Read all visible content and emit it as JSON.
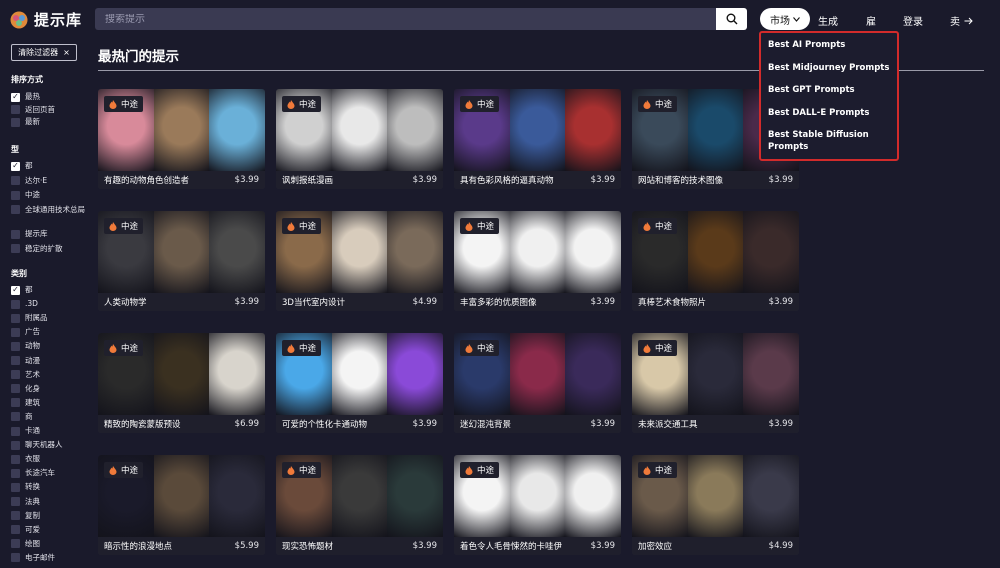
{
  "header": {
    "logo_text": "提示库",
    "search_placeholder": "搜索提示",
    "market_label": "市场",
    "nav": {
      "generate": "生成",
      "hire": "雇",
      "login": "登录",
      "sell": "卖"
    }
  },
  "dropdown": {
    "items": [
      "Best AI Prompts",
      "Best Midjourney Prompts",
      "Best GPT Prompts",
      "Best DALL-E Prompts",
      "Best Stable Diffusion Prompts"
    ]
  },
  "sidebar": {
    "clear_filters": "清除过滤器",
    "sort": {
      "heading": "排序方式",
      "options": [
        {
          "label": "最热",
          "checked": true
        },
        {
          "label": "返回页首",
          "checked": false
        },
        {
          "label": "最新",
          "checked": false
        }
      ]
    },
    "type": {
      "heading": "型",
      "options": [
        {
          "label": "都",
          "checked": true
        },
        {
          "label": "达尔·E",
          "checked": false
        },
        {
          "label": "中途",
          "checked": false
        },
        {
          "label": "全球通用技术总局",
          "checked": false
        },
        {
          "label": "提示库",
          "checked": false
        },
        {
          "label": "稳定的扩散",
          "checked": false
        }
      ]
    },
    "category": {
      "heading": "类别",
      "options": [
        {
          "label": "都",
          "checked": true
        },
        {
          "label": ".3D",
          "checked": false
        },
        {
          "label": "附属品",
          "checked": false
        },
        {
          "label": "广告",
          "checked": false
        },
        {
          "label": "动物",
          "checked": false
        },
        {
          "label": "动漫",
          "checked": false
        },
        {
          "label": "艺术",
          "checked": false
        },
        {
          "label": "化身",
          "checked": false
        },
        {
          "label": "建筑",
          "checked": false
        },
        {
          "label": "商",
          "checked": false
        },
        {
          "label": "卡通",
          "checked": false
        },
        {
          "label": "聊天机器人",
          "checked": false
        },
        {
          "label": "衣服",
          "checked": false
        },
        {
          "label": "长途汽车",
          "checked": false
        },
        {
          "label": "转换",
          "checked": false
        },
        {
          "label": "法典",
          "checked": false
        },
        {
          "label": "复制",
          "checked": false
        },
        {
          "label": "可爱",
          "checked": false
        },
        {
          "label": "绘图",
          "checked": false
        },
        {
          "label": "电子邮件",
          "checked": false
        }
      ]
    }
  },
  "main": {
    "title": "最热门的提示",
    "badge": "中途",
    "cards": [
      {
        "title": "有趣的动物角色创造者",
        "price": "$3.99",
        "colors": [
          "#d88a9a",
          "#9a7a5a",
          "#6ab0d8"
        ]
      },
      {
        "title": "讽刺报纸漫画",
        "price": "$3.99",
        "colors": [
          "#d0d0d0",
          "#e8e8e8",
          "#bdbdbd"
        ]
      },
      {
        "title": "具有色彩风格的逼真动物",
        "price": "$3.99",
        "colors": [
          "#5a3a8a",
          "#3a5a9a",
          "#a83030"
        ]
      },
      {
        "title": "网站和博客的技术图像",
        "price": "$3.99",
        "colors": [
          "#3a4a5a",
          "#1a4a6a",
          "#4a2a4a"
        ]
      },
      {
        "title": "人类动物学",
        "price": "$3.99",
        "colors": [
          "#3a3a40",
          "#6a5a4a",
          "#4a4a4a"
        ]
      },
      {
        "title": "3D当代室内设计",
        "price": "$4.99",
        "colors": [
          "#8a6a4a",
          "#d8ccbc",
          "#7a6a5a"
        ]
      },
      {
        "title": "丰富多彩的优质图像",
        "price": "$3.99",
        "colors": [
          "#f4f4f4",
          "#f0f0f0",
          "#f2f2f2"
        ]
      },
      {
        "title": "真棒艺术食物照片",
        "price": "$3.99",
        "colors": [
          "#2a2a2a",
          "#5a3a1a",
          "#3a2a2a"
        ]
      },
      {
        "title": "精致的陶瓷蒙版预设",
        "price": "$6.99",
        "colors": [
          "#2a2a2a",
          "#3a3020",
          "#d8d4cc"
        ]
      },
      {
        "title": "可爱的个性化卡通动物",
        "price": "$3.99",
        "colors": [
          "#4aa8e8",
          "#f4f4f4",
          "#8a4ad8"
        ]
      },
      {
        "title": "迷幻混沌背景",
        "price": "$3.99",
        "colors": [
          "#2a3a6a",
          "#8a2a4a",
          "#3a2a5a"
        ]
      },
      {
        "title": "未来派交通工具",
        "price": "$3.99",
        "colors": [
          "#d8c8a8",
          "#2a2a3a",
          "#5a3a4a"
        ]
      },
      {
        "title": "暗示性的浪漫地点",
        "price": "$5.99",
        "colors": [
          "#1a1a2a",
          "#5a4a3a",
          "#2a2a3a"
        ]
      },
      {
        "title": "现实恐怖题材",
        "price": "$3.99",
        "colors": [
          "#6a4a3a",
          "#3a3a3a",
          "#2a3a3a"
        ]
      },
      {
        "title": "着色令人毛骨悚然的卡哇伊",
        "price": "$3.99",
        "colors": [
          "#f4f4f4",
          "#e8e8e8",
          "#f0f0f0"
        ]
      },
      {
        "title": "加密效应",
        "price": "$4.99",
        "colors": [
          "#6a5a4a",
          "#8a7a5a",
          "#3a3a4a"
        ]
      }
    ]
  },
  "colors": {
    "background": "#1a1a2b",
    "dropdown_border": "#d22b2b",
    "accent_white": "#ffffff"
  }
}
